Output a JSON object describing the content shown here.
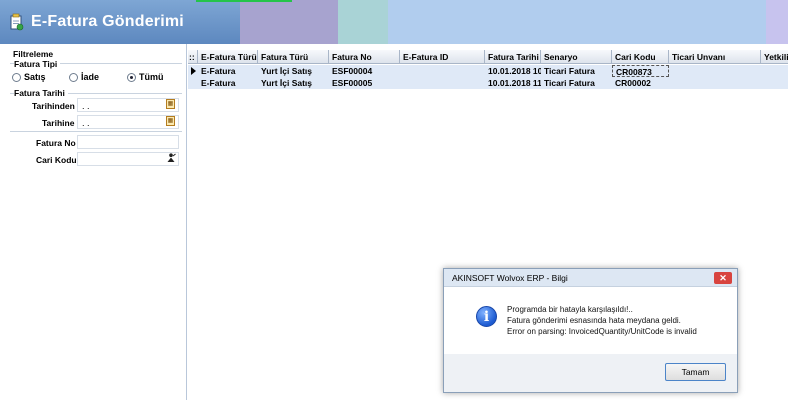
{
  "header": {
    "title": "E-Fatura Gönderimi",
    "icon": "document-edit-icon",
    "colors": {
      "title_bg": "#6c95c9",
      "accent_green": "#25c44a"
    }
  },
  "filter": {
    "heading": "Filtreleme",
    "invoice_type": {
      "label": "Fatura Tipi",
      "options": [
        "Satış",
        "İade",
        "Tümü"
      ],
      "selected": "Tümü"
    },
    "invoice_date": {
      "label": "Fatura Tarihi",
      "from_label": "Tarihinden",
      "from_value": ". .",
      "to_label": "Tarihine",
      "to_value": ". ."
    },
    "invoice_no_label": "Fatura No",
    "invoice_no_value": "",
    "customer_code_label": "Cari Kodu",
    "customer_code_value": ""
  },
  "grid": {
    "indicator_header": "::",
    "columns": [
      "E-Fatura Türü",
      "Fatura Türü",
      "Fatura No",
      "E-Fatura ID",
      "Fatura Tarihi",
      "Senaryo",
      "Cari Kodu",
      "Ticari Unvanı",
      "Yetkili"
    ],
    "rows": [
      [
        "E-Fatura",
        "Yurt İçi Satış",
        "ESF00004",
        "",
        "10.01.2018 10",
        "Ticari Fatura",
        "CR00873",
        "",
        ""
      ],
      [
        "E-Fatura",
        "Yurt İçi Satış",
        "ESF00005",
        "",
        "10.01.2018 11",
        "Ticari Fatura",
        "CR00002",
        "",
        ""
      ]
    ]
  },
  "dialog": {
    "title": "AKINSOFT Wolvox ERP - Bilgi",
    "close_symbol": "✕",
    "icon": "info-icon",
    "lines": [
      "Programda bir hatayla karşılaşıldı!..",
      "Fatura gönderimi esnasında hata meydana geldi.",
      "Error on parsing: InvoicedQuantity/UnitCode is invalid"
    ],
    "ok_label": "Tamam"
  }
}
